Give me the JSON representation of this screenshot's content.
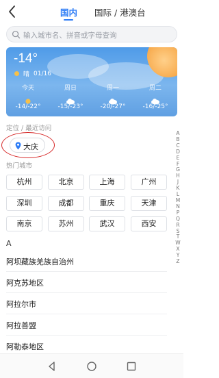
{
  "header": {
    "tabs": [
      {
        "label": "国内",
        "active": true
      },
      {
        "label": "国际 / 港澳台",
        "active": false
      }
    ]
  },
  "search": {
    "placeholder": "输入城市名、拼音或字母查询"
  },
  "weather": {
    "current_temp": "-14°",
    "condition": "晴",
    "date": "01/16",
    "forecast": [
      {
        "day": "今天",
        "icon": "sun-icon",
        "range": "-14/-22°"
      },
      {
        "day": "周日",
        "icon": "cloud-icon",
        "range": "-15/-23°"
      },
      {
        "day": "周一",
        "icon": "cloud-icon",
        "range": "-20/-27°"
      },
      {
        "day": "周二",
        "icon": "cloud-icon",
        "range": "-16/-25°"
      }
    ]
  },
  "location_section": {
    "label": "定位 / 最近访问",
    "current_city": "大庆"
  },
  "hot_section": {
    "label": "热门城市",
    "cities": [
      "杭州",
      "北京",
      "上海",
      "广州",
      "深圳",
      "成都",
      "重庆",
      "天津",
      "南京",
      "苏州",
      "武汉",
      "西安"
    ]
  },
  "alpha_index": [
    "A",
    "B",
    "C",
    "D",
    "E",
    "F",
    "G",
    "H",
    "J",
    "K",
    "L",
    "M",
    "N",
    "P",
    "Q",
    "R",
    "S",
    "T",
    "W",
    "X",
    "Y",
    "Z"
  ],
  "city_list": {
    "letter": "A",
    "items": [
      "阿坝藏族羌族自治州",
      "阿克苏地区",
      "阿拉尔市",
      "阿拉善盟",
      "阿勒泰地区"
    ]
  },
  "colors": {
    "accent": "#2d7cf6",
    "highlight_ring": "#d62828"
  }
}
